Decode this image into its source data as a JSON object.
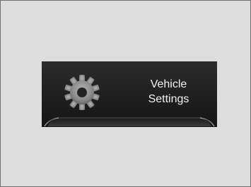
{
  "menu": {
    "item": {
      "icon": "gear-icon",
      "label_line1": "Vehicle",
      "label_line2": "Settings"
    }
  },
  "colors": {
    "background": "#dcdddf",
    "tile": "#1f1f1f",
    "text": "#f2f2f2",
    "icon": "#8a8a8a"
  }
}
